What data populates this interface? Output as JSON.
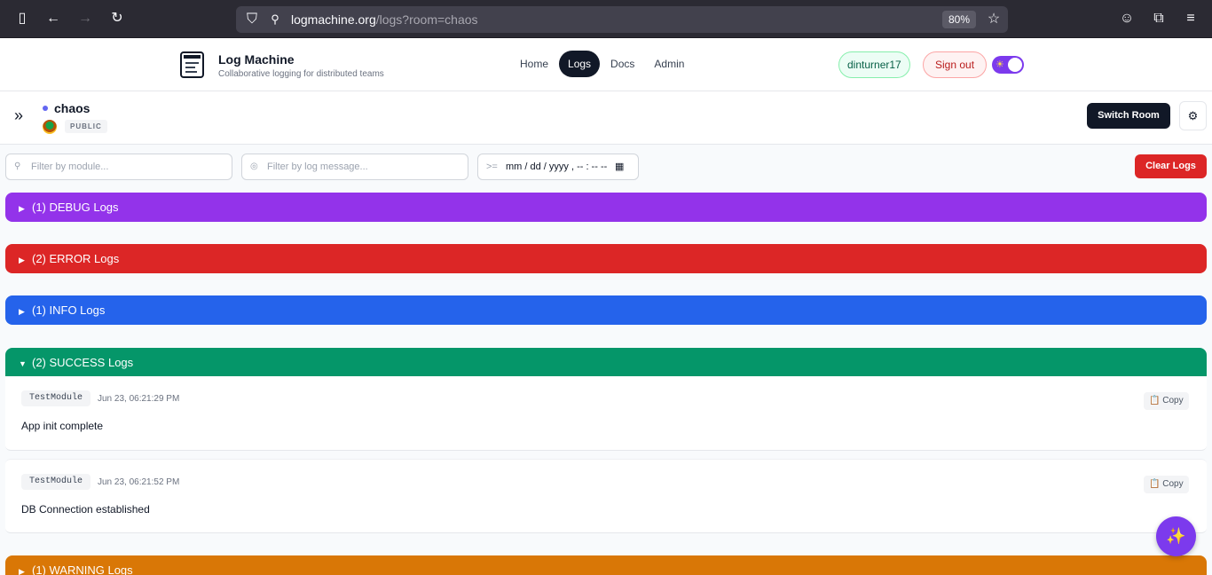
{
  "browser": {
    "url_domain": "logmachine.org",
    "url_path": "/logs?room=chaos",
    "zoom": "80%"
  },
  "app": {
    "title": "Log Machine",
    "subtitle": "Collaborative logging for distributed teams"
  },
  "nav": {
    "home": "Home",
    "logs": "Logs",
    "docs": "Docs",
    "admin": "Admin"
  },
  "user": {
    "username": "dinturner17",
    "signout": "Sign out"
  },
  "room": {
    "name": "chaos",
    "visibility": "PUBLIC",
    "switch_label": "Switch Room"
  },
  "filters": {
    "module_placeholder": "Filter by module...",
    "message_placeholder": "Filter by log message...",
    "date_prefix": ">=",
    "date_value": "mm / dd / yyyy ,  -- : --   --",
    "clear_label": "Clear Logs"
  },
  "groups": {
    "debug": {
      "label": "(1) DEBUG Logs",
      "color": "#9333ea"
    },
    "error": {
      "label": "(2) ERROR Logs",
      "color": "#dc2626"
    },
    "info": {
      "label": "(1) INFO Logs",
      "color": "#2563eb"
    },
    "success": {
      "label": "(2) SUCCESS Logs",
      "color": "#059669"
    },
    "warning": {
      "label": "(1) WARNING Logs",
      "color": "#d97706"
    }
  },
  "success_logs": [
    {
      "module": "TestModule",
      "time": "Jun 23, 06:21:29 PM",
      "message": "App init complete",
      "copy": "📋 Copy"
    },
    {
      "module": "TestModule",
      "time": "Jun 23, 06:21:52 PM",
      "message": "DB Connection established",
      "copy": "📋 Copy"
    }
  ],
  "icons": {
    "sidebar": "sidebar-icon",
    "back": "back-arrow-icon",
    "forward": "forward-arrow-icon",
    "reload": "reload-icon",
    "shield": "shield-icon",
    "star": "bookmark-star-icon",
    "extensions": "extensions-icon",
    "menu": "hamburger-menu-icon",
    "fab": "sparkles-icon"
  }
}
